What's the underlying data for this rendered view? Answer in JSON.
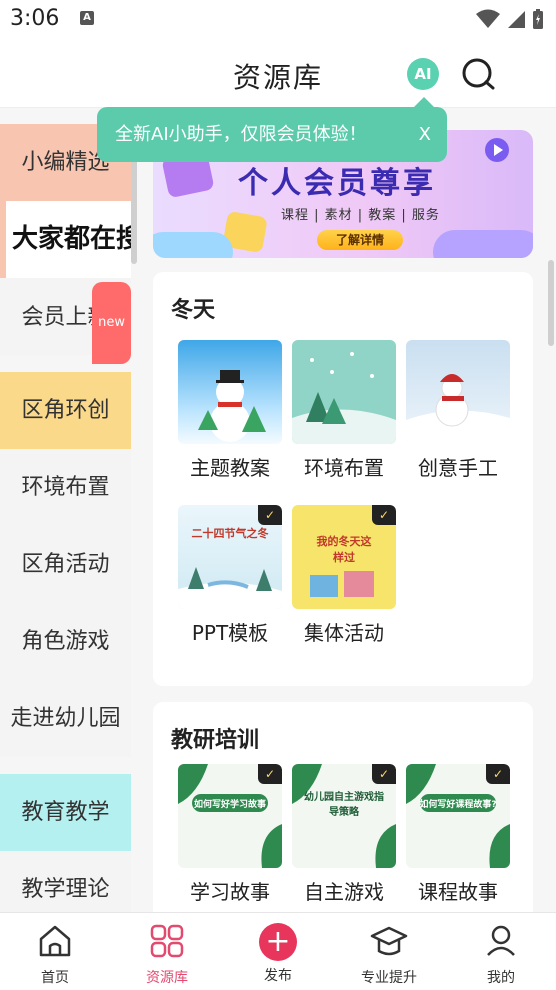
{
  "status_bar": {
    "time": "3:06",
    "notif_icon": "A"
  },
  "header": {
    "title": "资源库",
    "ai_label": "AI"
  },
  "tooltip": {
    "text": "全新AI小助手，仅限会员体验！",
    "close": "X"
  },
  "sidebar": {
    "items": [
      {
        "label": "小编精选"
      },
      {
        "label": "大家都在搜"
      },
      {
        "label": "会员上新",
        "badge": "new"
      },
      {
        "label": "区角环创"
      },
      {
        "label": "环境布置"
      },
      {
        "label": "区角活动"
      },
      {
        "label": "角色游戏"
      },
      {
        "label": "走进幼儿园"
      },
      {
        "label": "教育教学"
      },
      {
        "label": "教学理论"
      }
    ]
  },
  "banner": {
    "title": "个人会员尊享",
    "subtitle": "课程 | 素材 | 教案 | 服务",
    "button": "了解详情"
  },
  "sections": [
    {
      "title": "冬天",
      "tiles": [
        {
          "label": "主题教案"
        },
        {
          "label": "环境布置"
        },
        {
          "label": "创意手工"
        },
        {
          "label": "PPT模板",
          "thumb_text": "二十四节气之冬"
        },
        {
          "label": "集体活动",
          "thumb_text": "我的冬天这样过"
        }
      ]
    },
    {
      "title": "教研培训",
      "tiles": [
        {
          "label": "学习故事",
          "thumb_text": "如何写好学习故事"
        },
        {
          "label": "自主游戏",
          "thumb_text": "幼儿园自主游戏指导策略"
        },
        {
          "label": "课程故事",
          "thumb_text": "如何写好课程故事?"
        }
      ]
    }
  ],
  "tabbar": {
    "home": "首页",
    "library": "资源库",
    "publish": "发布",
    "pro": "专业提升",
    "me": "我的"
  },
  "colors": {
    "accent": "#e34a6f",
    "teal": "#5ccbab",
    "publish": "#e8355b"
  }
}
